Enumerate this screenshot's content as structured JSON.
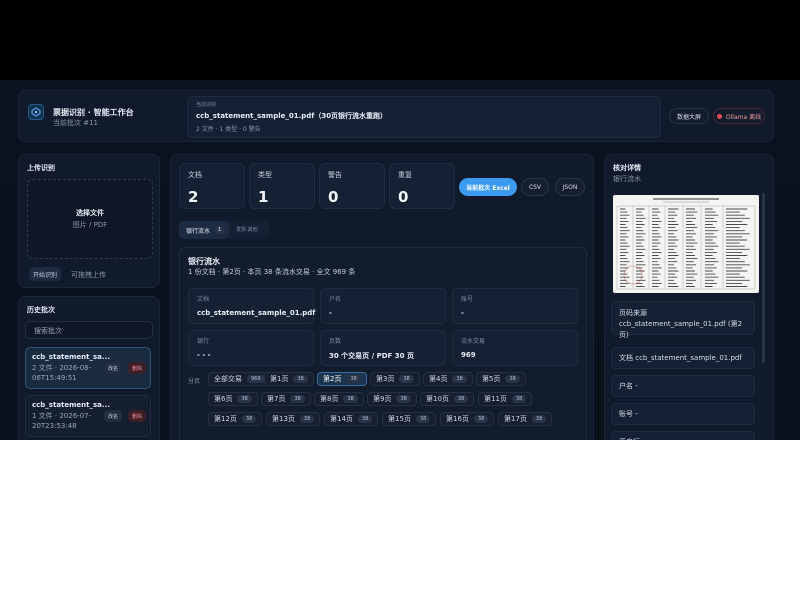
{
  "header": {
    "title": "票据识别 · 智能工作台",
    "batch": "当前批次 #11",
    "current_label": "当前识别",
    "file_title": "ccb_statement_sample_01.pdf（30页银行流水重跑）",
    "file_meta": "2 文件 · 1 类型 · 0 警告",
    "btn_dashboard": "数据大屏",
    "btn_ollama": "Ollama 离线",
    "ollama_color": "#e5484d"
  },
  "upload": {
    "title": "上传识别",
    "choose": "选择文件",
    "hint": "图片 / PDF",
    "btn_start": "开始识别",
    "tip": "可拖拽上传"
  },
  "history": {
    "title": "历史批次",
    "search_placeholder": "搜索批次",
    "items": [
      {
        "name": "ccb_statement_sa...",
        "meta1": "2 文件 · 2026-08-",
        "meta2": "06T15:49:51",
        "rename": "改名",
        "delete": "删除"
      },
      {
        "name": "ccb_statement_sa...",
        "meta1": "1 文件 · 2026-07-",
        "meta2": "20T23:53:48",
        "rename": "改名",
        "delete": "删除"
      }
    ]
  },
  "stats": [
    {
      "label": "文档",
      "value": "2"
    },
    {
      "label": "类型",
      "value": "1"
    },
    {
      "label": "警告",
      "value": "0"
    },
    {
      "label": "重复",
      "value": "0"
    }
  ],
  "actions": {
    "export_excel": "当前批次 Excel",
    "csv": "CSV",
    "json": "JSON"
  },
  "tabs": [
    {
      "label": "银行流水",
      "count": "1"
    },
    {
      "label": "发票·其他",
      "count": ""
    }
  ],
  "section": {
    "title": "银行流水",
    "subtitle": "1 份文档 · 第2页 · 本页 38 条流水交易 · 全文 969 条"
  },
  "fields": [
    {
      "key": "文档",
      "value": "ccb_statement_sample_01.pdf"
    },
    {
      "key": "户名",
      "value": "-"
    },
    {
      "key": "账号",
      "value": "-"
    },
    {
      "key": "银行",
      "value": "- - -"
    },
    {
      "key": "页数",
      "value": "30 个交易页 / PDF 30 页"
    },
    {
      "key": "流水交易",
      "value": "969"
    }
  ],
  "pages": {
    "label": "分页",
    "chips": [
      {
        "label": "全部交易",
        "count": "969"
      },
      {
        "label": "第1页",
        "count": "38"
      },
      {
        "label": "第2页",
        "count": "38"
      },
      {
        "label": "第3页",
        "count": "38"
      },
      {
        "label": "第4页",
        "count": "38"
      },
      {
        "label": "第5页",
        "count": "38"
      },
      {
        "label": "第6页",
        "count": "38"
      },
      {
        "label": "第7页",
        "count": "38"
      },
      {
        "label": "第8页",
        "count": "38"
      },
      {
        "label": "第9页",
        "count": "38"
      },
      {
        "label": "第10页",
        "count": "38"
      },
      {
        "label": "第11页",
        "count": "38"
      },
      {
        "label": "第12页",
        "count": "38"
      },
      {
        "label": "第13页",
        "count": "38"
      },
      {
        "label": "第14页",
        "count": "38"
      },
      {
        "label": "第15页",
        "count": "38"
      },
      {
        "label": "第16页",
        "count": "38"
      },
      {
        "label": "第17页",
        "count": "38"
      }
    ],
    "active_index": 2
  },
  "detail": {
    "title": "核对详情",
    "subtitle": "银行流水",
    "source": "页码来源 ccb_statement_sample_01.pdf (第2页)",
    "doc": "文档 ccb_statement_sample_01.pdf",
    "name_label": "户名 -",
    "account_label": "账号 -",
    "bank_label": "开户行 -"
  }
}
